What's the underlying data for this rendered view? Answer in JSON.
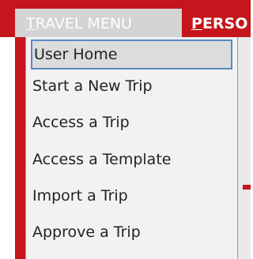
{
  "menubar": {
    "travel_menu": {
      "first_letter": "T",
      "rest": "RAVEL MENU"
    },
    "personal_menu": {
      "first_letter": "P",
      "rest": "ERSO"
    }
  },
  "dropdown": {
    "items": [
      {
        "label": "User Home",
        "selected": true
      },
      {
        "label": "Start a New Trip"
      },
      {
        "label": "Access a Trip"
      },
      {
        "label": "Access a Template"
      },
      {
        "label": "Import a Trip"
      },
      {
        "label": "Approve a Trip"
      }
    ]
  },
  "colors": {
    "menubar": "#c4161c",
    "selection_border": "#5b89c7",
    "dropdown_bg": "#f2f2f2"
  }
}
